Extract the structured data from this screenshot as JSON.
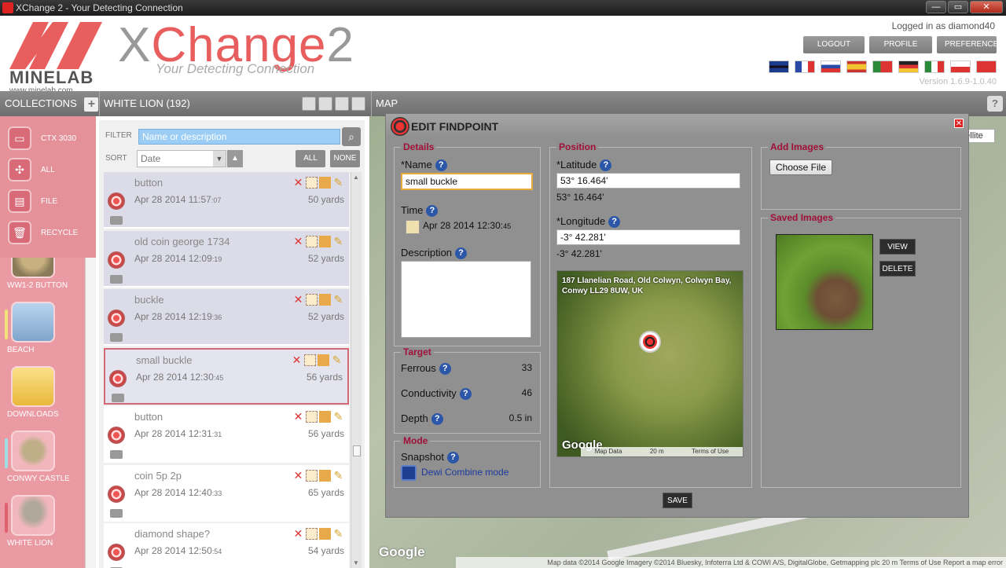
{
  "window": {
    "title": "XChange 2 - Your Detecting Connection",
    "controls": [
      "—",
      "▭",
      "✕"
    ]
  },
  "header": {
    "logo_word": "MINELAB",
    "logo_url": "www.minelab.com",
    "app_title_x": "X",
    "app_title_c": "Change",
    "app_title_2": "2",
    "tagline": "Your Detecting Connection",
    "logged_in": "Logged in as diamond40",
    "buttons": {
      "logout": "LOGOUT",
      "profile": "PROFILE",
      "preferences": "PREFERENCES"
    },
    "flags": [
      "uk-flag",
      "france-flag",
      "russia-flag",
      "spain-flag",
      "portugal-flag",
      "germany-flag",
      "italy-flag",
      "poland-flag",
      "turkey-flag"
    ],
    "version": "Version 1.6.9-1.0.40"
  },
  "toolbar": {
    "collections": "COLLECTIONS",
    "collection_name": "WHITE LION (192)",
    "map": "MAP",
    "help": "?"
  },
  "devices": [
    {
      "label": "CTX 3030",
      "icon": "device-icon"
    },
    {
      "label": "ALL",
      "icon": "all-icon"
    },
    {
      "label": "FILE",
      "icon": "file-icon"
    },
    {
      "label": "RECYCLE",
      "icon": "recycle-icon"
    }
  ],
  "collections": [
    {
      "label": "WW1-2 BUTTON"
    },
    {
      "label": "BEACH"
    },
    {
      "label": "DOWNLOADS"
    },
    {
      "label": "CONWY CASTLE"
    },
    {
      "label": "WHITE LION"
    }
  ],
  "list": {
    "filter_label": "FILTER",
    "filter_placeholder": "Name or description",
    "sort_label": "SORT",
    "sort_value": "Date",
    "all": "ALL",
    "none": "NONE",
    "items": [
      {
        "name": "button",
        "date": "Apr 28 2014  11:57",
        "secs": "07",
        "distance": "50 yards"
      },
      {
        "name": "old coin george 1734",
        "date": "Apr 28 2014  12:09",
        "secs": "19",
        "distance": "52 yards"
      },
      {
        "name": "buckle",
        "date": "Apr 28 2014  12:19",
        "secs": "36",
        "distance": "52 yards"
      },
      {
        "name": "small buckle",
        "date": "Apr 28 2014  12:30",
        "secs": "45",
        "distance": "56 yards"
      },
      {
        "name": "button",
        "date": "Apr 28 2014  12:31",
        "secs": "31",
        "distance": "56 yards"
      },
      {
        "name": "coin 5p 2p",
        "date": "Apr 28 2014  12:40",
        "secs": "33",
        "distance": "65 yards"
      },
      {
        "name": "diamond shape?",
        "date": "Apr 28 2014  12:50",
        "secs": "54",
        "distance": "54 yards"
      }
    ]
  },
  "map": {
    "satellite_btn": "atellite",
    "google": "Google",
    "attribution": "Map data ©2014 Google Imagery ©2014 Bluesky, Infoterra Ltd & COWI A/S, DigitalGlobe, Getmapping plc   20 m        Terms of Use   Report a map error"
  },
  "dialog": {
    "title": "EDIT FINDPOINT",
    "details": {
      "legend": "Details",
      "name_label": "*Name",
      "name_value": "small buckle",
      "time_label": "Time",
      "time_value": "Apr 28 2014  12:30",
      "time_secs": "45",
      "description_label": "Description"
    },
    "target": {
      "legend": "Target",
      "ferrous_label": "Ferrous",
      "ferrous": "33",
      "conductivity_label": "Conductivity",
      "conductivity": "46",
      "depth_label": "Depth",
      "depth": "0.5 in"
    },
    "mode": {
      "legend": "Mode",
      "snapshot_label": "Snapshot",
      "snapshot_value": "Dewi Combine mode"
    },
    "position": {
      "legend": "Position",
      "lat_label": "*Latitude",
      "lat_value": "53° 16.464'",
      "lat_display": "53° 16.464'",
      "lon_label": "*Longitude",
      "lon_value": "-3° 42.281'",
      "lon_display": "-3° 42.281'",
      "address": "187 Llanelian Road, Old Colwyn, Colwyn Bay, Conwy LL29 8UW, UK",
      "google": "Google",
      "map_data": "Map Data",
      "scale": "20 m",
      "terms": "Terms of Use"
    },
    "add_images": {
      "legend": "Add Images",
      "choose_file": "Choose File"
    },
    "saved_images": {
      "legend": "Saved Images",
      "view": "VIEW",
      "delete": "DELETE"
    },
    "save": "SAVE"
  }
}
